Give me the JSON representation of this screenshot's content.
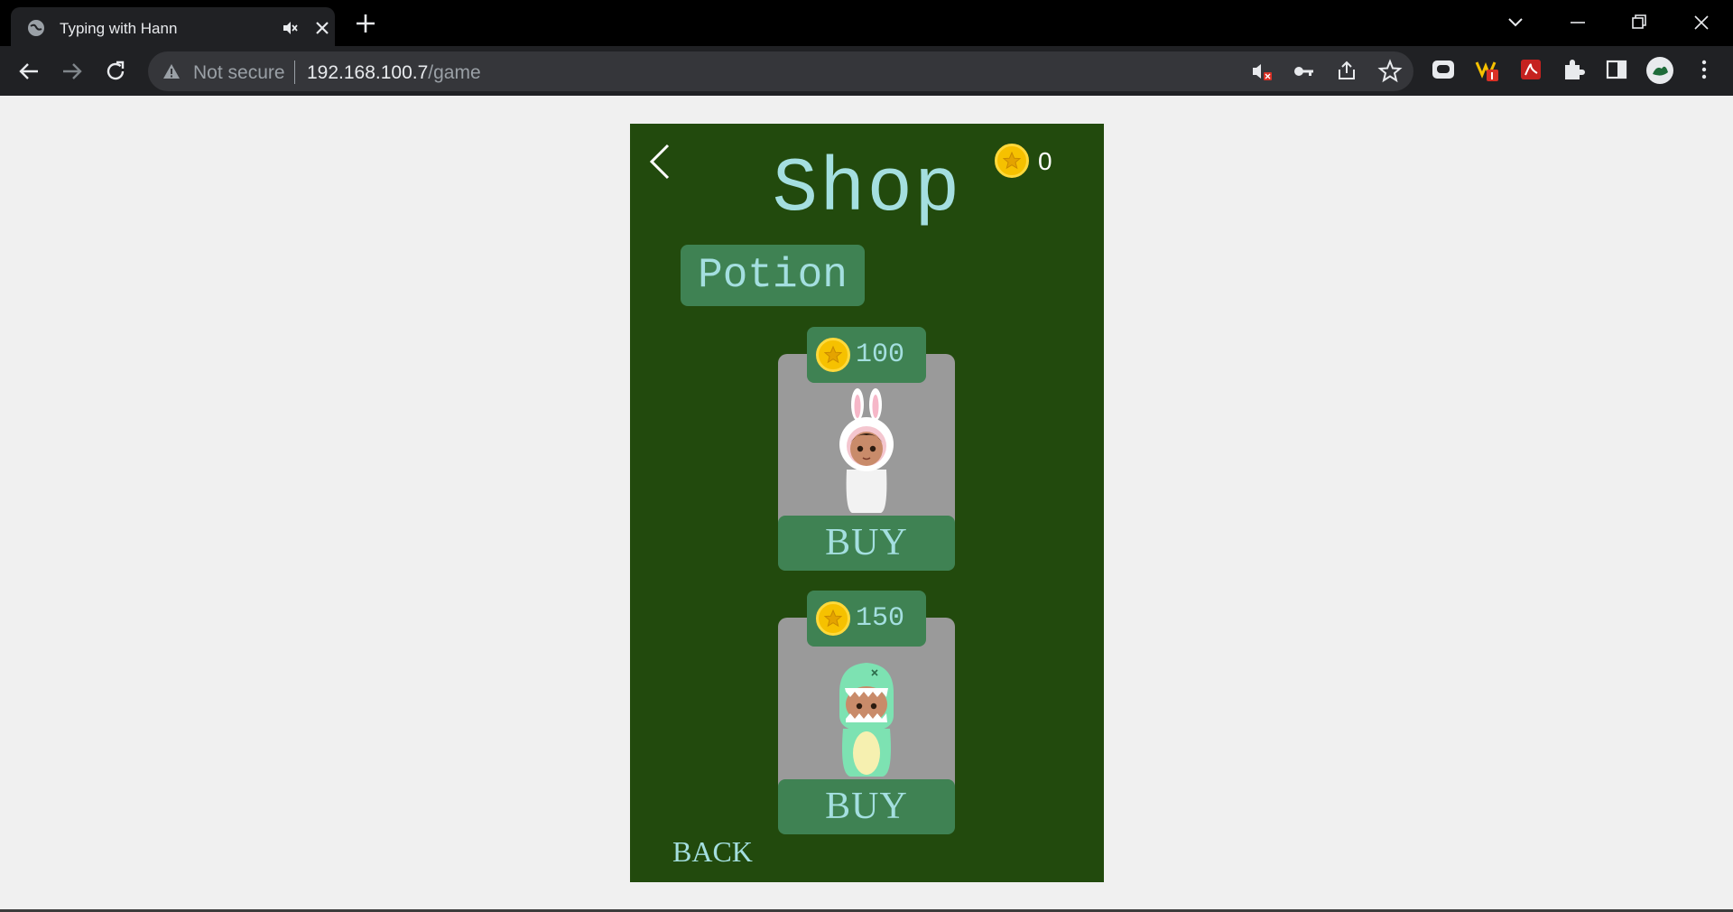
{
  "browser": {
    "tab_title": "Typing with Hann",
    "security_label": "Not secure",
    "url_host": "192.168.100.7",
    "url_path": "/game"
  },
  "shop": {
    "title": "Shop",
    "coins": "0",
    "category_tab": "Potion",
    "items": [
      {
        "price": "100",
        "buy_label": "BUY",
        "character": "bunny-costume"
      },
      {
        "price": "150",
        "buy_label": "BUY",
        "character": "dino-costume"
      }
    ],
    "back_label": "BACK"
  },
  "colors": {
    "panel_bg": "#224a0d",
    "button_bg": "#3f8253",
    "text_accent": "#a4dfe0",
    "card_bg": "#9a9a9a",
    "coin": "#f6c100"
  }
}
